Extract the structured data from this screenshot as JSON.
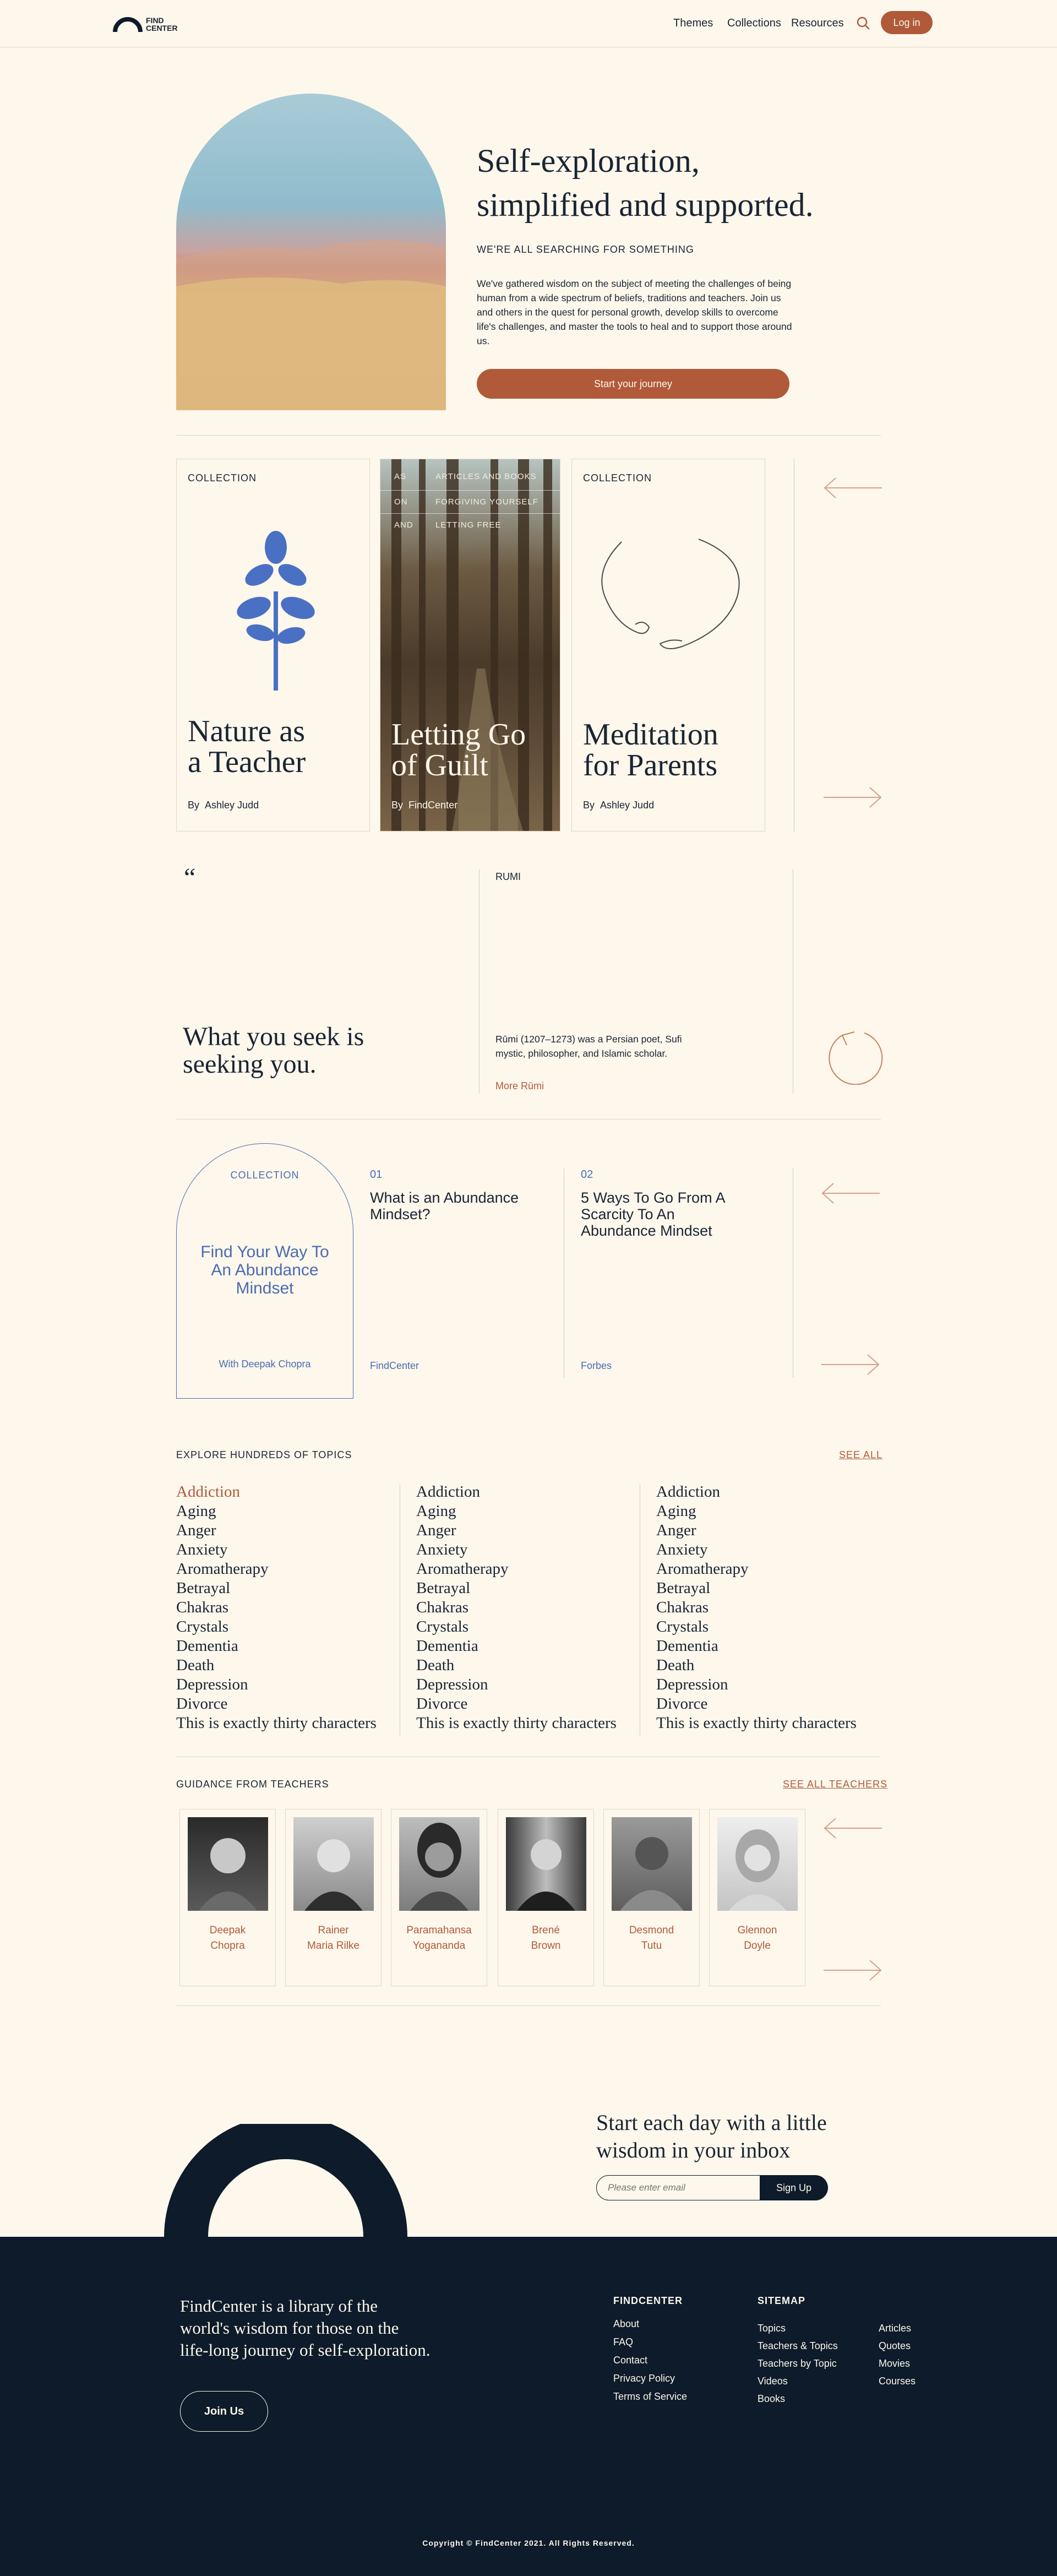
{
  "header": {
    "logo_line1": "FIND",
    "logo_line2": "CENTER",
    "nav": [
      "Themes",
      "Collections",
      "Resources"
    ],
    "login": "Log in"
  },
  "hero": {
    "title_line1": "Self-exploration,",
    "title_line2": "simplified and supported.",
    "eyebrow": "WE'RE ALL SEARCHING FOR SOMETHING",
    "body": "We've gathered wisdom on the subject of meeting the challenges of being human from a wide spectrum of beliefs, traditions and teachers. Join us and others in the quest for personal growth, develop skills to overcome life's challenges, and master the tools to heal and to support those around us.",
    "cta": "Start your journey"
  },
  "collections": [
    {
      "tag": "COLLECTION",
      "title_line1": "Nature as",
      "title_line2": "a Teacher",
      "by": "By",
      "author": "Ashley Judd"
    },
    {
      "meta": [
        [
          "AS",
          "ARTICLES AND BOOKS"
        ],
        [
          "ON",
          "FORGIVING YOURSELF"
        ],
        [
          "AND",
          "LETTING FREE"
        ]
      ],
      "title_line1": "Letting Go",
      "title_line2": "of Guilt",
      "by": "By",
      "author": "FindCenter"
    },
    {
      "tag": "COLLECTION",
      "title_line1": "Meditation",
      "title_line2": "for Parents",
      "by": "By",
      "author": "Ashley Judd"
    }
  ],
  "quote": {
    "mark": "“",
    "text_line1": "What you seek is",
    "text_line2": "seeking you.",
    "name": "RUMI",
    "bio": "Rūmi (1207–1273) was a Persian poet, Sufi mystic, philosopher, and Islamic scholar.",
    "more": "More Rūmi"
  },
  "abundance": {
    "tag": "COLLECTION",
    "title": "Find Your Way To An Abundance Mindset",
    "with": "With Deepak Chopra",
    "items": [
      {
        "num": "01",
        "title": "What is an Abundance Mindset?",
        "source": "FindCenter"
      },
      {
        "num": "02",
        "title": "5 Ways To Go From A Scarcity To An Abundance Mindset",
        "source": "Forbes"
      }
    ]
  },
  "topics": {
    "heading": "EXPLORE HUNDREDS OF TOPICS",
    "see_all": "SEE ALL",
    "list": [
      "Addiction",
      "Aging",
      "Anger",
      "Anxiety",
      "Aromatherapy",
      "Betrayal",
      "Chakras",
      "Crystals",
      "Dementia",
      "Death",
      "Depression",
      "Divorce",
      "This is exactly thirty characters"
    ]
  },
  "teachers": {
    "heading": "GUIDANCE FROM TEACHERS",
    "see_all": "SEE ALL TEACHERS",
    "list": [
      [
        "Deepak",
        "Chopra"
      ],
      [
        "Rainer",
        "Maria Rilke"
      ],
      [
        "Paramahansa",
        "Yogananda"
      ],
      [
        "Brené",
        "Brown"
      ],
      [
        "Desmond",
        "Tutu"
      ],
      [
        "Glennon",
        "Doyle"
      ]
    ]
  },
  "newsletter": {
    "title_line1": "Start each day with a little",
    "title_line2": "wisdom in your inbox",
    "placeholder": "Please enter email",
    "button": "Sign Up"
  },
  "footer": {
    "tagline_line1": "FindCenter is a library of the",
    "tagline_line2": "world's  wisdom for those on the",
    "tagline_line3": "life-long journey of self-exploration.",
    "join": "Join Us",
    "col1_head": "FINDCENTER",
    "col1": [
      "About",
      "FAQ",
      "Contact",
      "Privacy Policy",
      "Terms of Service"
    ],
    "col2_head": "SITEMAP",
    "col2": [
      "Topics",
      "Teachers & Topics",
      "Teachers by Topic",
      "Videos",
      "Books"
    ],
    "col3": [
      "Articles",
      "Quotes",
      "Movies",
      "Courses"
    ],
    "copyright": "Copyright © FindCenter 2021. All Rights Reserved."
  },
  "colors": {
    "background": "#fdf7ec",
    "accent": "#b05a3a",
    "navy": "#0d1b2a",
    "blue": "#4a6cb0"
  }
}
